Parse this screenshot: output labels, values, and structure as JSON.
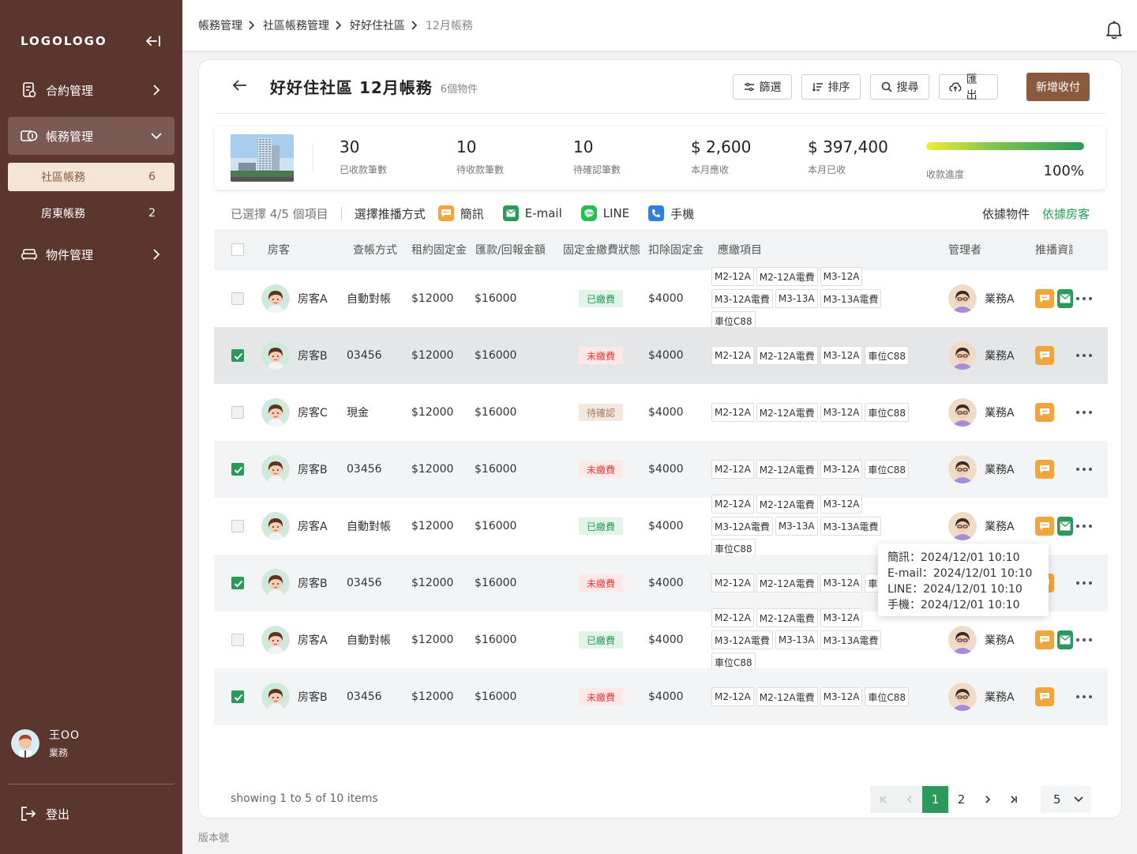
{
  "sidebar": {
    "logo": "LOGOLOGO",
    "nav": [
      {
        "label": "合約管理"
      },
      {
        "label": "帳務管理"
      },
      {
        "label": "物件管理"
      }
    ],
    "sub": [
      {
        "label": "社區帳務",
        "count": "6"
      },
      {
        "label": "房東帳務",
        "count": "2"
      }
    ],
    "user": {
      "name": "王OO",
      "role": "業務"
    },
    "logout": "登出"
  },
  "breadcrumb": [
    "帳務管理",
    "社區帳務管理",
    "好好住社區",
    "12月帳務"
  ],
  "page": {
    "title": "好好住社區 12月帳務",
    "subtitle": "6個物件",
    "buttons": {
      "filter": "篩選",
      "sort": "排序",
      "search": "搜尋",
      "export": "匯出",
      "add": "新增收付"
    }
  },
  "stats": [
    {
      "value": "30",
      "label": "已收款筆數"
    },
    {
      "value": "10",
      "label": "待收款筆數"
    },
    {
      "value": "10",
      "label": "待確認筆數"
    },
    {
      "value": "$ 2,600",
      "label": "本月應收"
    },
    {
      "value": "$ 397,400",
      "label": "本月已收"
    }
  ],
  "progress": {
    "label": "收款進度",
    "value": "100%",
    "fraction": 1.0
  },
  "select_bar": {
    "count": "已選擇 4/5 個項目",
    "prompt": "選擇推播方式",
    "channels": [
      "簡訊",
      "E-mail",
      "LINE",
      "手機"
    ],
    "toggle": [
      "依據物件",
      "依據房客"
    ]
  },
  "table": {
    "headers": [
      "房客",
      "查帳方式",
      "租約固定金",
      "匯款/回報金額",
      "固定金繳費狀態",
      "扣除固定金",
      "應繳項目",
      "管理者",
      "推播資訊"
    ],
    "rows": [
      {
        "tenant": "房客A",
        "method": "自動對帳",
        "rent": "$12000",
        "remit": "$16000",
        "status": "已繳費",
        "status_kind": "paid",
        "deduct": "$4000",
        "items": [
          "M2-12A",
          "M2-12A電費",
          "M3-12A",
          "M3-12A電費",
          "M3-13A",
          "M3-13A電費",
          "車位C88"
        ],
        "manager": "業務A",
        "checked": false,
        "mail": true
      },
      {
        "tenant": "房客B",
        "method": "03456",
        "rent": "$12000",
        "remit": "$16000",
        "status": "未繳費",
        "status_kind": "unpaid",
        "deduct": "$4000",
        "items": [
          "M2-12A",
          "M2-12A電費",
          "M3-12A",
          "車位C88"
        ],
        "manager": "業務A",
        "checked": true,
        "mail": false
      },
      {
        "tenant": "房客C",
        "method": "現金",
        "rent": "$12000",
        "remit": "$16000",
        "status": "待確認",
        "status_kind": "pending",
        "deduct": "$4000",
        "items": [
          "M2-12A",
          "M2-12A電費",
          "M3-12A",
          "車位C88"
        ],
        "manager": "業務A",
        "checked": false,
        "mail": false
      },
      {
        "tenant": "房客B",
        "method": "03456",
        "rent": "$12000",
        "remit": "$16000",
        "status": "未繳費",
        "status_kind": "unpaid",
        "deduct": "$4000",
        "items": [
          "M2-12A",
          "M2-12A電費",
          "M3-12A",
          "車位C88"
        ],
        "manager": "業務A",
        "checked": true,
        "mail": false
      },
      {
        "tenant": "房客A",
        "method": "自動對帳",
        "rent": "$12000",
        "remit": "$16000",
        "status": "已繳費",
        "status_kind": "paid",
        "deduct": "$4000",
        "items": [
          "M2-12A",
          "M2-12A電費",
          "M3-12A",
          "M3-12A電費",
          "M3-13A",
          "M3-13A電費",
          "車位C88"
        ],
        "manager": "業務A",
        "checked": false,
        "mail": true
      },
      {
        "tenant": "房客B",
        "method": "03456",
        "rent": "$12000",
        "remit": "$16000",
        "status": "未繳費",
        "status_kind": "unpaid",
        "deduct": "$4000",
        "items": [
          "M2-12A",
          "M2-12A電費",
          "M3-12A",
          "車位C88"
        ],
        "manager": "業務A",
        "checked": true,
        "mail": false
      },
      {
        "tenant": "房客A",
        "method": "自動對帳",
        "rent": "$12000",
        "remit": "$16000",
        "status": "已繳費",
        "status_kind": "paid",
        "deduct": "$4000",
        "items": [
          "M2-12A",
          "M2-12A電費",
          "M3-12A",
          "M3-12A電費",
          "M3-13A",
          "M3-13A電費",
          "車位C88"
        ],
        "manager": "業務A",
        "checked": false,
        "mail": true
      },
      {
        "tenant": "房客B",
        "method": "03456",
        "rent": "$12000",
        "remit": "$16000",
        "status": "未繳費",
        "status_kind": "unpaid",
        "deduct": "$4000",
        "items": [
          "M2-12A",
          "M2-12A電費",
          "M3-12A",
          "車位C88"
        ],
        "manager": "業務A",
        "checked": true,
        "mail": false
      }
    ]
  },
  "tooltip": [
    "簡訊：2024/12/01 10:10",
    "E-mail：2024/12/01 10:10",
    "LINE：2024/12/01 10:10",
    "手機：2024/12/01 10:10"
  ],
  "footer": {
    "showing": "showing 1 to 5 of 10 items",
    "pages": [
      "1",
      "2"
    ],
    "page_size": "5",
    "version": "版本號"
  },
  "colors": {
    "sidebar": "#5a362e",
    "accent": "#8a5a3f",
    "green": "#2a9a5a",
    "red": "#e33c3c"
  }
}
